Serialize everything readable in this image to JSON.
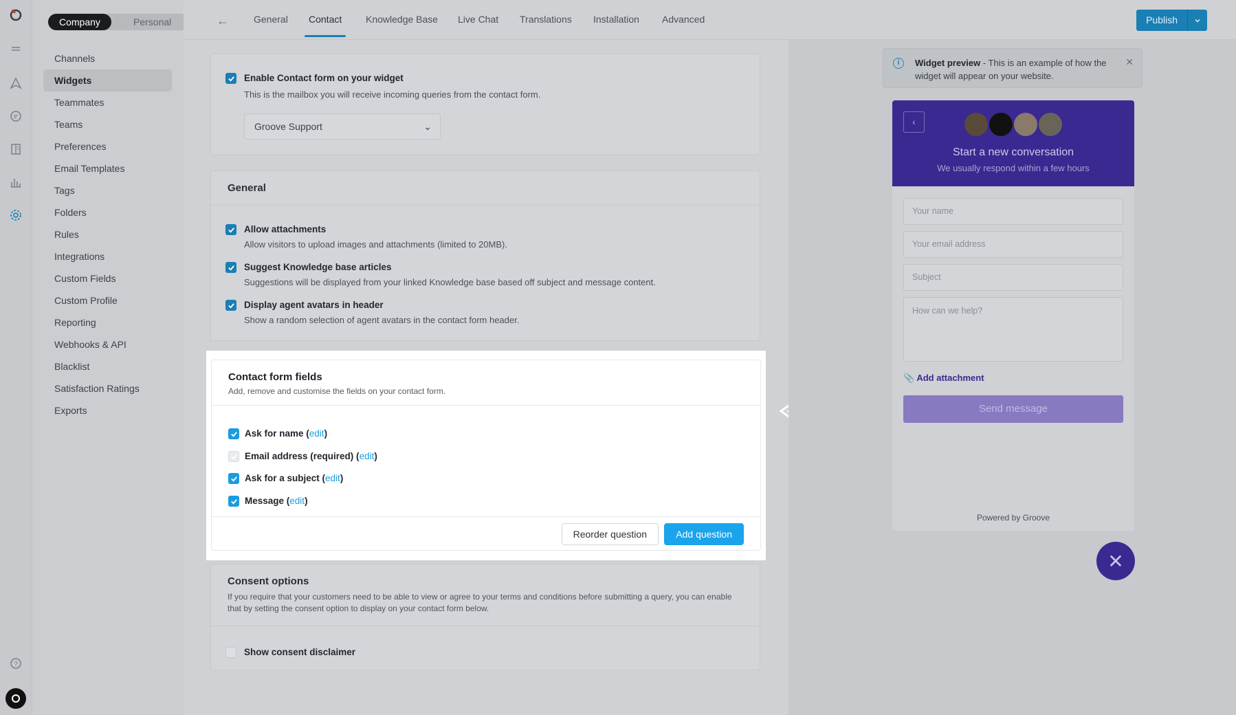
{
  "rail": {
    "icons": [
      "groove-logo-icon",
      "menu-icon",
      "send-icon",
      "chat-icon",
      "book-icon",
      "chart-icon",
      "settings-icon",
      "help-icon",
      "user-avatar-icon"
    ]
  },
  "subnav": {
    "toggle": {
      "company": "Company",
      "personal": "Personal"
    },
    "items": [
      "Channels",
      "Widgets",
      "Teammates",
      "Teams",
      "Preferences",
      "Email Templates",
      "Tags",
      "Folders",
      "Rules",
      "Integrations",
      "Custom Fields",
      "Custom Profile",
      "Reporting",
      "Webhooks & API",
      "Blacklist",
      "Satisfaction Ratings",
      "Exports"
    ],
    "active": "Widgets"
  },
  "header": {
    "tabs": [
      "General",
      "Contact",
      "Knowledge Base",
      "Live Chat",
      "Translations",
      "Installation",
      "Advanced"
    ],
    "active_tab": "Contact",
    "publish_label": "Publish"
  },
  "contact_card": {
    "enable_label": "Enable Contact form on your widget",
    "enable_desc": "This is the mailbox you will receive incoming queries from the contact form.",
    "mailbox_value": "Groove Support"
  },
  "general_card": {
    "title": "General",
    "options": [
      {
        "label": "Allow attachments",
        "desc": "Allow visitors to upload images and attachments (limited to 20MB).",
        "checked": true
      },
      {
        "label": "Suggest Knowledge base articles",
        "desc": "Suggestions will be displayed from your linked Knowledge base based off subject and message content.",
        "checked": true
      },
      {
        "label": "Display agent avatars in header",
        "desc": "Show a random selection of agent avatars in the contact form header.",
        "checked": true
      }
    ]
  },
  "fields_card": {
    "title": "Contact form fields",
    "subtitle": "Add, remove and customise the fields on your contact form.",
    "fields": [
      {
        "label": "Ask for name (",
        "edit": "edit",
        "close": ")",
        "checked": true
      },
      {
        "label": "Email address (required) (",
        "edit": "edit",
        "close": ")",
        "checked": true,
        "disabled": true
      },
      {
        "label": "Ask for a subject (",
        "edit": "edit",
        "close": ")",
        "checked": true
      },
      {
        "label": "Message (",
        "edit": "edit",
        "close": ")",
        "checked": true
      }
    ],
    "reorder_label": "Reorder question",
    "add_label": "Add question"
  },
  "consent_card": {
    "title": "Consent options",
    "desc": "If you require that your customers need to be able to view or agree to your terms and conditions before submitting a query, you can enable that by setting the consent option to display on your contact form below.",
    "checkbox_label": "Show consent disclaimer",
    "checked": false
  },
  "preview": {
    "notice_bold": "Widget preview",
    "notice_text": " - This is an example of how the widget will appear on your website.",
    "widget": {
      "title": "Start a new conversation",
      "subtitle": "We usually respond within a few hours",
      "placeholders": [
        "Your name",
        "Your email address",
        "Subject",
        "How can we help?"
      ],
      "attach_label": "Add attachment",
      "send_label": "Send message",
      "powered": "Powered by Groove"
    }
  },
  "colors": {
    "accent": "#1aa4eb",
    "widget": "#3a2990"
  }
}
